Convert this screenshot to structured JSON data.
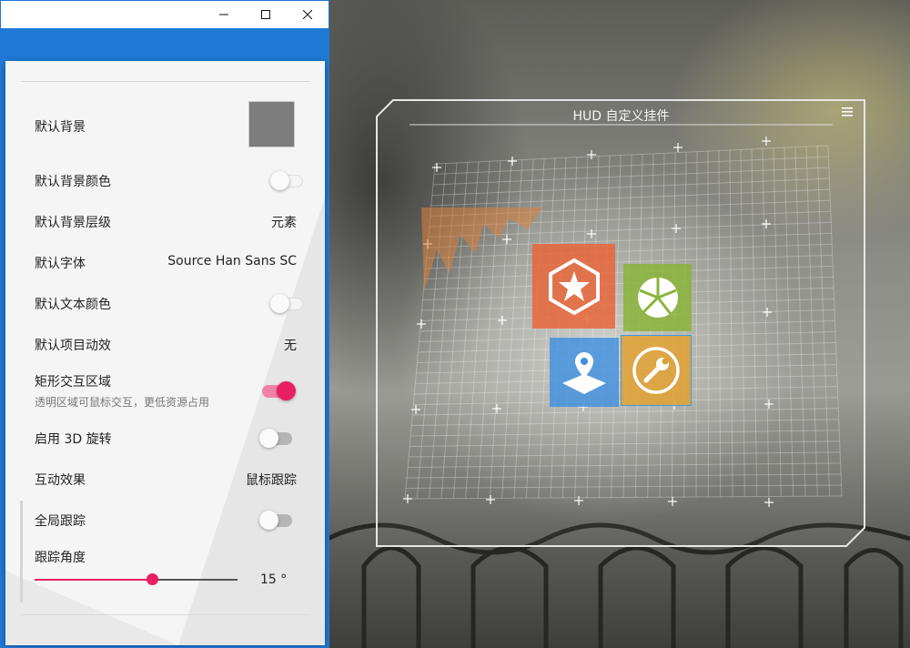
{
  "window": {
    "minimize_icon": "minimize-icon",
    "maximize_icon": "maximize-icon",
    "close_icon": "close-icon",
    "accent_color": "#1e78d4"
  },
  "settings": {
    "rows": {
      "default_background": {
        "label": "默认背景",
        "swatch_color": "#7d7d7d"
      },
      "default_background_color": {
        "label": "默认背景颜色",
        "enabled": false
      },
      "default_background_level": {
        "label": "默认背景层级",
        "value": "元素"
      },
      "default_font": {
        "label": "默认字体",
        "value": "Source Han Sans SC"
      },
      "default_text_color": {
        "label": "默认文本颜色",
        "enabled": false
      },
      "default_item_animation": {
        "label": "默认项目动效",
        "value": "无"
      },
      "rect_interaction_area": {
        "label": "矩形交互区域",
        "description": "透明区域可鼠标交互，更低资源占用",
        "enabled": true
      },
      "enable_3d_rotation": {
        "label": "启用 3D 旋转",
        "enabled": false
      },
      "interaction_effect": {
        "label": "互动效果",
        "value": "鼠标跟踪"
      },
      "global_tracking": {
        "label": "全局跟踪",
        "enabled": false
      },
      "tracking_angle": {
        "label": "跟踪角度",
        "value_text": "15 °",
        "value": 15,
        "fraction": 0.58
      }
    },
    "accent": "#e91e63"
  },
  "hud": {
    "title": "HUD 自定义挂件",
    "menu_icon": "hamburger-menu-icon",
    "tiles": [
      {
        "name": "star-hexagon-tile",
        "icon": "star-hexagon-icon",
        "color": "#e8663a"
      },
      {
        "name": "pie-chart-tile",
        "icon": "pie-chart-icon",
        "color": "#8ab43a"
      },
      {
        "name": "map-pin-tile",
        "icon": "map-pin-icon",
        "color": "#3d8ee0"
      },
      {
        "name": "wrench-tile",
        "icon": "wrench-icon",
        "color": "#e0a030"
      }
    ]
  }
}
